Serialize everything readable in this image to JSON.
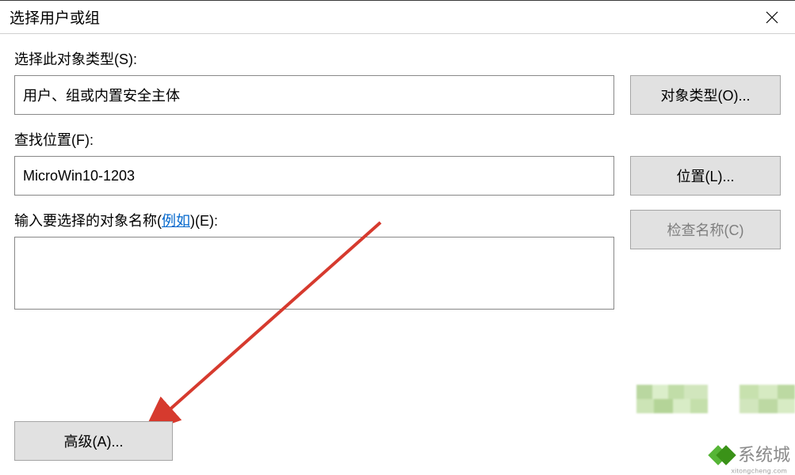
{
  "window": {
    "title": "选择用户或组"
  },
  "section1": {
    "label": "选择此对象类型(S):",
    "value": "用户、组或内置安全主体",
    "button": "对象类型(O)..."
  },
  "section2": {
    "label": "查找位置(F):",
    "value": "MicroWin10-1203",
    "button": "位置(L)..."
  },
  "section3": {
    "label_prefix": "输入要选择的对象名称(",
    "label_link": "例如",
    "label_suffix": ")(E):",
    "value": "",
    "button": "检查名称(C)"
  },
  "footer": {
    "advanced": "高级(A)..."
  },
  "watermark": {
    "text": "系统城",
    "url": "xitongcheng.com"
  }
}
